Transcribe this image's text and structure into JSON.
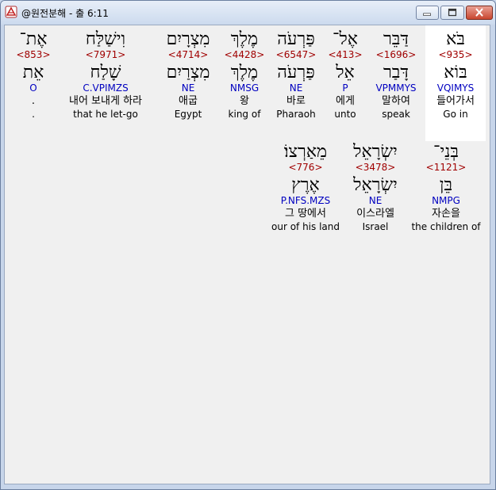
{
  "window": {
    "title": "@원전분해 - 출 6:11"
  },
  "icons": {
    "app": "app-logo-icon",
    "minimize": "minimize-icon",
    "maximize": "maximize-icon",
    "close": "close-icon"
  },
  "colors": {
    "strong_number": "#a00000",
    "parsing": "#0000c0",
    "selected_bg": "#ffffff",
    "panel_bg": "#f0f0f0"
  },
  "rows": [
    {
      "words": [
        {
          "hebrew": "בֹּא",
          "strong": "<935>",
          "lemma": "בּוֹא",
          "parse": "VQIMYS",
          "korean": "들어가서",
          "english": "Go in",
          "selected": true
        },
        {
          "hebrew": "דַּבֵּר",
          "strong": "<1696>",
          "lemma": "דָּבַר",
          "parse": "VPMMYS",
          "korean": "말하여",
          "english": "speak"
        },
        {
          "hebrew": "אֶל־",
          "strong": "<413>",
          "lemma": "אֵל",
          "parse": "P",
          "korean": "에게",
          "english": "unto"
        },
        {
          "hebrew": "פַּרְעֹה",
          "strong": "<6547>",
          "lemma": "פַּרְעֹה",
          "parse": "NE",
          "korean": "바로",
          "english": "Pharaoh"
        },
        {
          "hebrew": "מֶלֶךְ",
          "strong": "<4428>",
          "lemma": "מֶלֶךְ",
          "parse": "NMSG",
          "korean": "왕",
          "english": "king of"
        },
        {
          "hebrew": "מִצְרָיִם",
          "strong": "<4714>",
          "lemma": "מִצְרַיִם",
          "parse": "NE",
          "korean": "애굽",
          "english": "Egypt"
        },
        {
          "hebrew": "וִישַׁלַּח",
          "strong": "<7971>",
          "lemma": "שָׁלַח",
          "parse": "C.VPIMZS",
          "korean": "내어 보내게 하라",
          "english": "that he let-go"
        },
        {
          "hebrew": "אֶת־",
          "strong": "<853>",
          "lemma": "אֵת",
          "parse": "O",
          "korean": ".",
          "english": "."
        }
      ]
    },
    {
      "words": [
        {
          "hebrew": "בְּנֵי־",
          "strong": "<1121>",
          "lemma": "בֵּן",
          "parse": "NMPG",
          "korean": "자손을",
          "english": "the children of"
        },
        {
          "hebrew": "יִשְׂרָאֵל",
          "strong": "<3478>",
          "lemma": "יִשְׂרָאֵל",
          "parse": "NE",
          "korean": "이스라엘",
          "english": "Israel"
        },
        {
          "hebrew": "מֵאַרְצוֹ׃",
          "strong": "<776>",
          "lemma": "אֶרֶץ",
          "parse": "P.NFS.MZS",
          "korean": "그 땅에서",
          "english": "our of his land"
        }
      ]
    }
  ]
}
